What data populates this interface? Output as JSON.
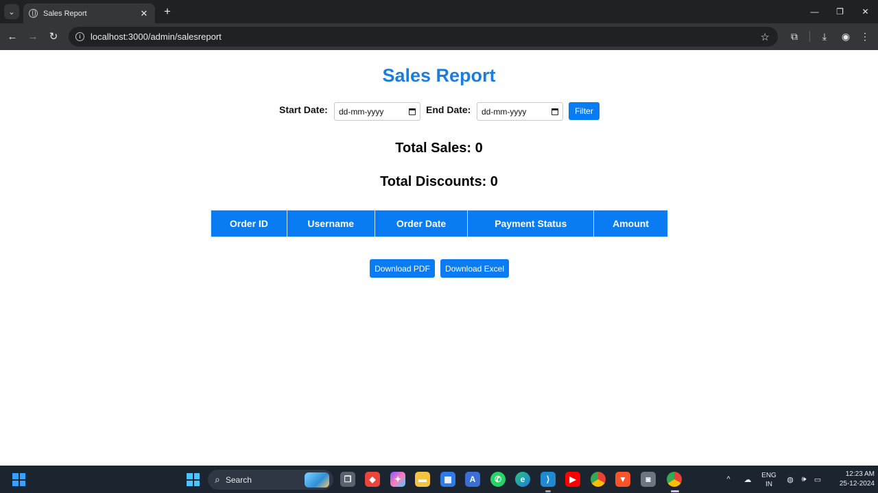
{
  "browser": {
    "tab_title": "Sales Report",
    "tab_close": "✕",
    "new_tab": "+",
    "url": "localhost:3000/admin/salesreport"
  },
  "page": {
    "title": "Sales Report",
    "filter": {
      "start_label": "Start Date:",
      "start_placeholder": "dd-mm-yyyy",
      "end_label": "End Date:",
      "end_placeholder": "dd-mm-yyyy",
      "button": "Filter"
    },
    "total_sales": "Total Sales: 0",
    "total_discounts": "Total Discounts: 0",
    "table": {
      "columns": [
        "Order ID",
        "Username",
        "Order Date",
        "Payment Status",
        "Amount"
      ],
      "rows": []
    },
    "download_pdf": "Download PDF",
    "download_excel": "Download Excel"
  },
  "taskbar": {
    "search_label": "Search",
    "lang_line1": "ENG",
    "lang_line2": "IN",
    "time": "12:23 AM",
    "date": "25-12-2024"
  },
  "colors": {
    "accent": "#0a7cf3",
    "title": "#1e7ce0"
  }
}
